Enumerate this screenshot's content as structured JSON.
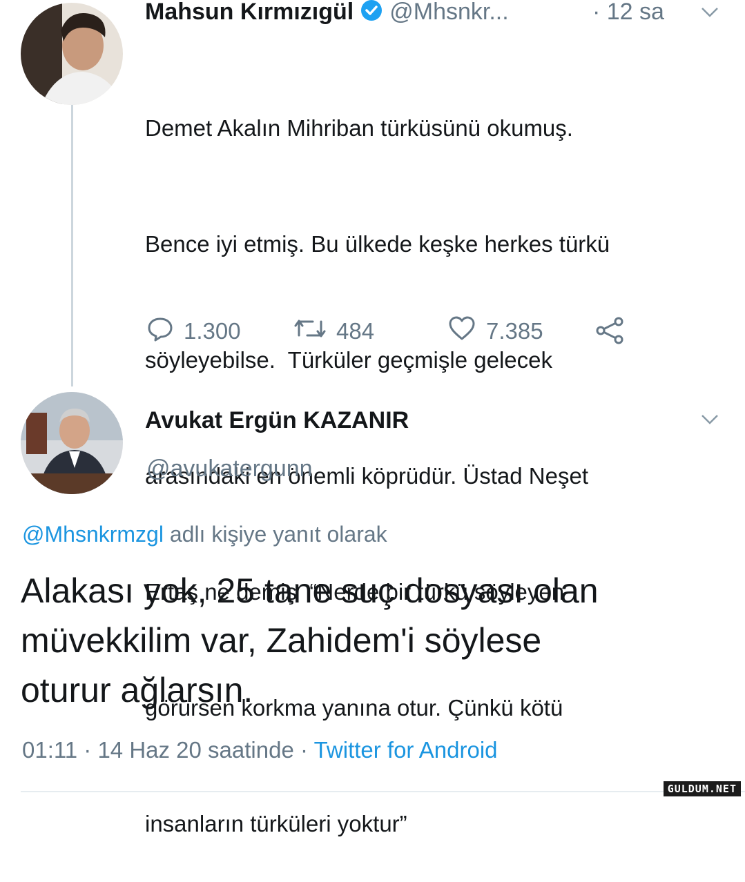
{
  "tweet1": {
    "author_name": "Mahsun Kırmızıgül",
    "handle": "@Mhsnkr...",
    "time": "· 12 sa",
    "lines": [
      "Demet Akalın Mihriban türküsünü okumuş.",
      "Bence iyi etmiş. Bu ülkede keşke herkes türkü",
      "söyleyebilse.  Türküler geçmişle gelecek",
      "arasındaki en önemli köprüdür. Üstad Neşet",
      "Ertaş ne demiş  “Nerde bir türkü söyleyen",
      "görürsen korkma yanına otur. Çünkü kötü",
      "insanların türküleri yoktur”"
    ],
    "replies": "1.300",
    "retweets": "484",
    "likes": "7.385",
    "icons": [
      "verified-badge-icon",
      "chevron-down-icon",
      "reply-icon",
      "retweet-icon",
      "like-icon",
      "share-icon"
    ]
  },
  "tweet2": {
    "author_name": "Avukat Ergün KAZANIR",
    "handle": "@avukatergunn",
    "reply_mention": "@Mhsnkrmzgl",
    "reply_suffix": "adlı kişiye yanıt olarak",
    "lines": [
      "Alakası yok, 25 tane suç dosyası olan",
      "müvekkilim var, Zahidem'i söylese",
      "oturur ağlarsın."
    ],
    "meta_time": "01:11 · 14 Haz 20 saatinde ·",
    "source": "Twitter for Android"
  },
  "watermark": "GULDUM.NET",
  "colors": {
    "link": "#1b95e0",
    "muted": "#657786",
    "text": "#14171a",
    "verified": "#1da1f2"
  }
}
